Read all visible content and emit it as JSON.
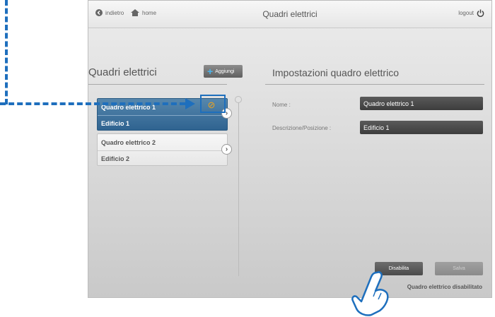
{
  "header": {
    "back_label": "indietro",
    "home_label": "home",
    "title": "Quadri elettrici",
    "logout_label": "logout"
  },
  "left_panel": {
    "title": "Quadri elettrici",
    "add_label": "Aggiungi",
    "items": [
      {
        "name": "Quadro elettrico 1",
        "location": "Edificio 1",
        "selected": true
      },
      {
        "name": "Quadro elettrico 2",
        "location": "Edificio 2",
        "selected": false
      }
    ]
  },
  "right_panel": {
    "title": "Impostazioni quadro elettrico",
    "fields": [
      {
        "label": "Nome :",
        "value": "Quadro elettrico 1"
      },
      {
        "label": "Descrizione/Posizione :",
        "value": "Edificio 1"
      }
    ],
    "disable_label": "Disabilita",
    "save_label": "Salva",
    "status_text": "Quadro elettrico disabilitato"
  },
  "colors": {
    "accent": "#1e6fbd",
    "selected_item": "#3a6e98",
    "disable_icon": "#f0a319",
    "add_plus": "#4ab3ea"
  },
  "icons": [
    "back-icon",
    "home-icon",
    "power-icon",
    "plus-icon",
    "chevron-right-icon",
    "disable-icon",
    "pointing-hand-icon"
  ]
}
